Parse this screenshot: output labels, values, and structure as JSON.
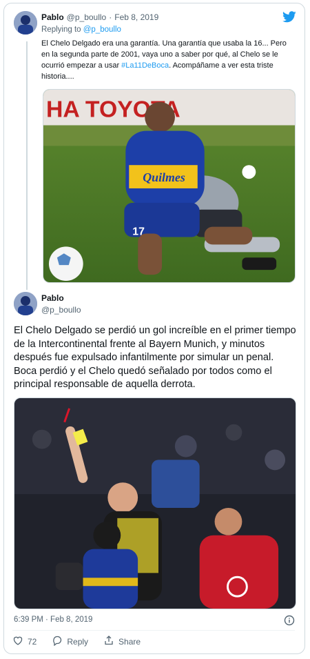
{
  "tweet1": {
    "name": "Pablo",
    "handle": "@p_boullo",
    "sep": "·",
    "date": "Feb 8, 2019",
    "reply_prefix": "Replying to ",
    "reply_handle": "@p_boullo",
    "text_before": "El Chelo Delgado era una garantía. Una garantía que usaba la 16... Pero en la segunda parte de 2001, vaya uno a saber por qué, al Chelo se le ocurrió empezar a usar ",
    "hashtag": "#La11DeBoca",
    "text_after": ". Acompáñame a ver esta triste historia...."
  },
  "tweet2": {
    "name": "Pablo",
    "handle": "@p_boullo",
    "text": "El Chelo Delgado se perdió un gol increíble en el primer tiempo de la Intercontinental frente al Bayern Munich, y minutos después fue expulsado infantilmente por simular un penal. Boca perdió y el Chelo quedó señalado por todos como el principal responsable de aquella derrota.",
    "timestamp": "6:39 PM · Feb 8, 2019"
  },
  "actions": {
    "like_count": "72",
    "reply_label": "Reply",
    "share_label": "Share"
  },
  "icons": {
    "brand": "twitter-bird-icon",
    "info": "info-icon",
    "like": "heart-icon",
    "reply": "reply-bubble-icon",
    "share": "share-icon"
  },
  "colors": {
    "accent": "#1d9bf0",
    "text": "#0f1419",
    "muted": "#536471",
    "border": "#cfd9de"
  },
  "images": {
    "photo1_banner": "HA TOYOTA",
    "photo1_sponsor": "Quilmes",
    "photo1_number": "17"
  }
}
